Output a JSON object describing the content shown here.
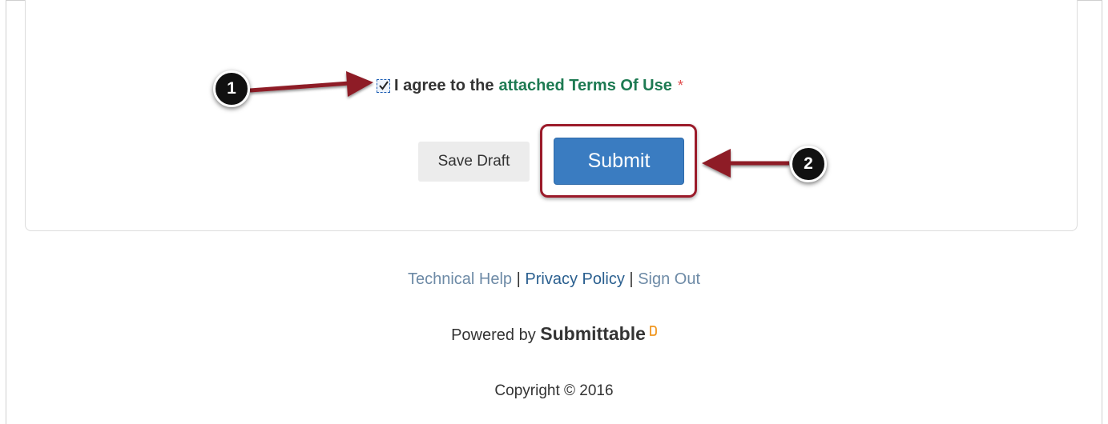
{
  "form": {
    "agree_prefix": "I agree to the",
    "terms_link": "attached Terms Of Use",
    "required_marker": "*",
    "checkbox_checked": true,
    "save_draft_label": "Save Draft",
    "submit_label": "Submit"
  },
  "callouts": {
    "step1": "1",
    "step2": "2"
  },
  "footer": {
    "technical_help": "Technical Help",
    "separator": "|",
    "privacy_policy": "Privacy Policy",
    "sign_out": "Sign Out",
    "powered_by": "Powered by",
    "brand": "Submittable",
    "brand_icon": "submittable-logo-icon",
    "copyright": "Copyright © 2016"
  },
  "colors": {
    "submit": "#3a7cc1",
    "link_green": "#1d7a52",
    "annotation": "#9b1b2a",
    "brand_orange": "#f0961e"
  }
}
